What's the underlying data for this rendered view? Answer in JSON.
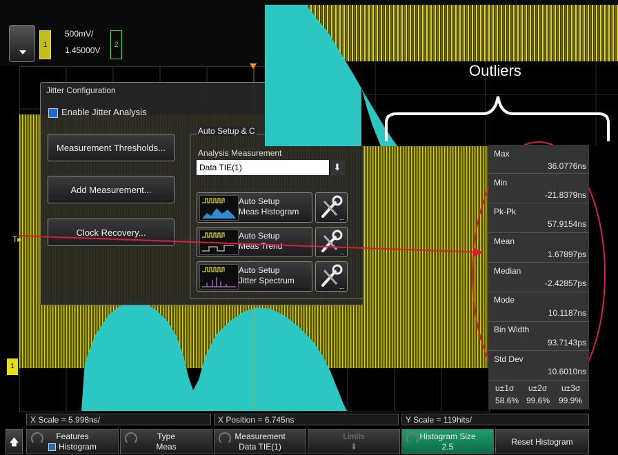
{
  "topbar": {
    "channel1": {
      "number": "1",
      "scale": "500mV/",
      "offset": "1.45000V"
    },
    "channel2": {
      "number": "2"
    }
  },
  "dialog": {
    "title": "Jitter Configuration",
    "enable_label": "Enable Jitter Analysis",
    "buttons": [
      "Measurement Thresholds...",
      "Add Measurement...",
      "Clock Recovery..."
    ],
    "group_title": "Auto Setup & C",
    "analysis_label": "Analysis Measurement",
    "analysis_value": "Data TIE(1)",
    "auto_setups": [
      {
        "line1": "Auto Setup",
        "line2": "Meas Histogram"
      },
      {
        "line1": "Auto Setup",
        "line2": "Meas Trend"
      },
      {
        "line1": "Auto Setup",
        "line2": "Jitter Spectrum"
      }
    ]
  },
  "callout": {
    "label": "Outliers"
  },
  "measurements": [
    {
      "name": "Max",
      "value": "36.0776ns"
    },
    {
      "name": "Min",
      "value": "-21.8379ns"
    },
    {
      "name": "Pk-Pk",
      "value": "57.9154ns"
    },
    {
      "name": "Mean",
      "value": "1.67897ps"
    },
    {
      "name": "Median",
      "value": "-2.42857ps"
    },
    {
      "name": "Mode",
      "value": "10.1187ns"
    },
    {
      "name": "Bin Width",
      "value": "93.7143ps"
    },
    {
      "name": "Std Dev",
      "value": "10.6010ns"
    }
  ],
  "sigma": {
    "headers": [
      "u±1σ",
      "u±2σ",
      "u±3σ"
    ],
    "values": [
      "58.6%",
      "99.6%",
      "99.9%"
    ]
  },
  "infobar": {
    "x_scale": "X Scale = 5.998ns/",
    "x_position": "X Position = 6.745ns",
    "y_scale": "Y Scale = 119hits/"
  },
  "softkeys": {
    "features_label": "Features",
    "features_value": "Histogram",
    "type_label": "Type",
    "type_value": "Meas",
    "measurement_label": "Measurement",
    "measurement_value": "Data TIE(1)",
    "limits_label": "Limits",
    "hist_size_label": "Histogram Size",
    "hist_size_value": "2.5",
    "reset_label": "Reset Histogram"
  },
  "colors": {
    "ch1": "#e4de1a",
    "ch2": "#56d75d",
    "histogram": "#2cc7c2",
    "annotation": "#d8203c",
    "active_softkey": "#1e9e6e"
  }
}
